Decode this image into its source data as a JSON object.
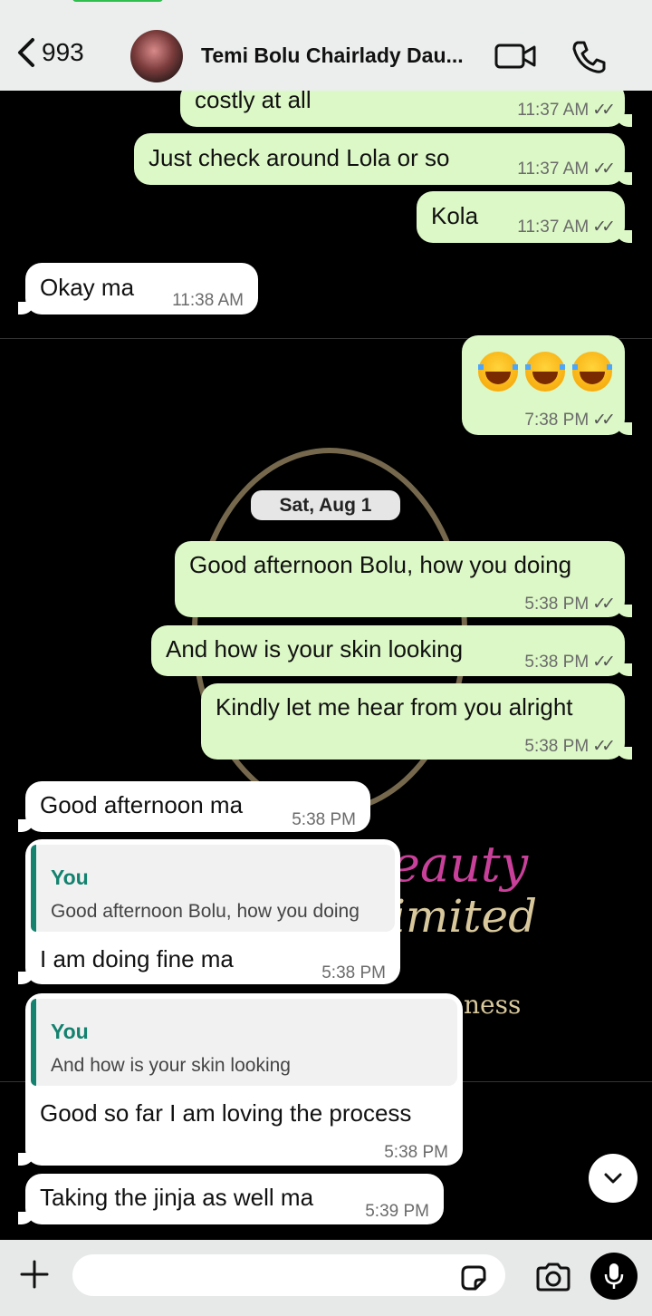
{
  "header": {
    "back_count": "993",
    "contact_name": "Temi Bolu Chairlady  Dau..."
  },
  "messages": [
    {
      "dir": "out",
      "text": "costly at all",
      "time": "11:37 AM"
    },
    {
      "dir": "out",
      "text": "Just check around Lola or so",
      "time": "11:37 AM"
    },
    {
      "dir": "out",
      "text": "Kola",
      "time": "11:37 AM"
    },
    {
      "dir": "in",
      "text": "Okay ma",
      "time": "11:38 AM"
    },
    {
      "dir": "out",
      "text": "😂😂😂",
      "time": "7:38 PM"
    },
    {
      "dir": "out",
      "text": "Good afternoon Bolu, how you doing",
      "time": "5:38 PM"
    },
    {
      "dir": "out",
      "text": "And how is your skin looking",
      "time": "5:38 PM"
    },
    {
      "dir": "out",
      "text": "Kindly let me hear from you alright",
      "time": "5:38 PM"
    },
    {
      "dir": "in",
      "text": "Good afternoon ma",
      "time": "5:38 PM"
    },
    {
      "dir": "in",
      "quote_name": "You",
      "quote_text": "Good afternoon Bolu, how you doing",
      "text": "I am doing fine ma",
      "time": "5:38 PM"
    },
    {
      "dir": "in",
      "quote_name": "You",
      "quote_text": "And how is your skin looking",
      "text": "Good so far I am loving the process",
      "time": "5:38 PM"
    },
    {
      "dir": "in",
      "text": "Taking the jinja as well ma",
      "time": "5:39 PM"
    }
  ],
  "date_separator": "Sat, Aug 1",
  "background_logo": {
    "line1": "eauty",
    "line2": "imited",
    "line3": "ness"
  },
  "input": {
    "placeholder": ""
  },
  "colors": {
    "outgoing": "#dcf8c6",
    "incoming": "#ffffff",
    "quote_accent": "#14826f",
    "background": "#000000"
  },
  "icons": [
    "back-chevron-icon",
    "video-call-icon",
    "phone-icon",
    "scroll-down-icon",
    "plus-icon",
    "sticker-icon",
    "camera-icon",
    "mic-icon"
  ]
}
